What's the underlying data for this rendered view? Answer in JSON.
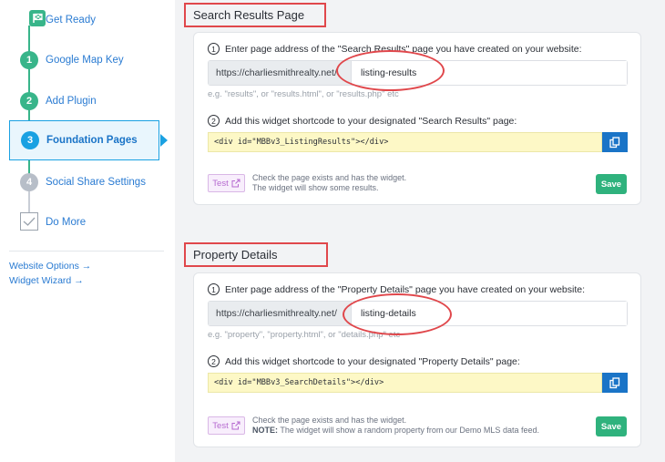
{
  "sidebar": {
    "steps": [
      {
        "number": "",
        "label": "Get Ready",
        "state": "done",
        "icon": "flag-icon"
      },
      {
        "number": "1",
        "label": "Google Map Key",
        "state": "done"
      },
      {
        "number": "2",
        "label": "Add Plugin",
        "state": "done"
      },
      {
        "number": "3",
        "label": "Foundation Pages",
        "state": "active"
      },
      {
        "number": "4",
        "label": "Social Share Settings",
        "state": "pending"
      },
      {
        "number": "",
        "label": "Do More",
        "state": "pending",
        "icon": "checkbox-icon"
      }
    ],
    "links": [
      {
        "label": "Website Options",
        "arrow": "→"
      },
      {
        "label": "Widget Wizard",
        "arrow": "→"
      }
    ]
  },
  "sections": [
    {
      "heading": "Search Results Page",
      "step1_number": "1",
      "step1_text": "Enter page address of the \"Search Results\" page you have created on your website:",
      "url_prefix": "https://charliesmithrealty.net/",
      "url_value": "listing-results",
      "hint": "e.g. \"results\", or \"results.html\", or \"results.php\" etc",
      "step2_number": "2",
      "step2_text": "Add this widget shortcode to your designated \"Search Results\" page:",
      "shortcode": "<div id=\"MBBv3_ListingResults\"></div>",
      "test_label": "Test",
      "test_desc_line1": "Check the page exists and has the widget.",
      "test_desc_bold": "",
      "test_desc_line2": "The widget will show some results.",
      "save_label": "Save"
    },
    {
      "heading": "Property Details",
      "step1_number": "1",
      "step1_text": "Enter page address of the \"Property Details\" page you have created on your website:",
      "url_prefix": "https://charliesmithrealty.net/",
      "url_value": "listing-details",
      "hint": "e.g. \"property\", \"property.html\", or \"details.php\" etc",
      "step2_number": "2",
      "step2_text": "Add this widget shortcode to your designated \"Property Details\" page:",
      "shortcode": "<div id=\"MBBv3_SearchDetails\"></div>",
      "test_label": "Test",
      "test_desc_line1": "Check the page exists and has the widget.",
      "test_desc_bold": "NOTE:",
      "test_desc_line2": "The widget will show a random property from our Demo MLS data feed.",
      "save_label": "Save"
    }
  ],
  "colors": {
    "accent_green": "#38b58a",
    "accent_blue": "#1aa1e2",
    "annotation_red": "#e0474b",
    "save_green": "#2fb27d"
  }
}
